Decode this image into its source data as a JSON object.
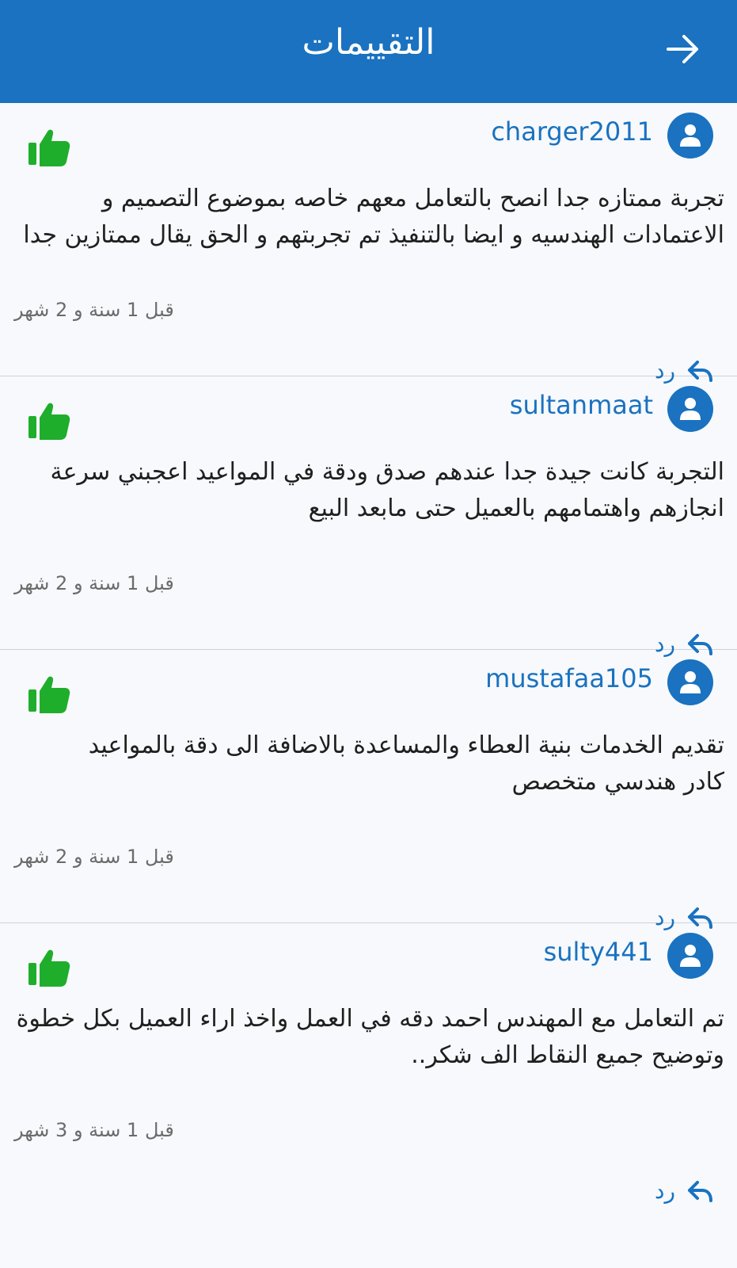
{
  "header": {
    "title": "التقييمات",
    "back_icon": "arrow-right-icon",
    "background": "#1a72c0"
  },
  "reviews": [
    {
      "username": "charger2011",
      "text": "تجربة ممتازه جدا انصح بالتعامل معهم خاصه بموضوع التصميم و الاعتمادات الهندسيه و ايضا بالتنفيذ تم تجربتهم و الحق يقال ممتازين جدا",
      "time": "قبل 1 سنة و 2 شهر",
      "reply_label": "رد"
    },
    {
      "username": "sultanmaat",
      "text": "التجربة كانت جيدة جدا عندهم صدق ودقة في المواعيد اعجبني سرعة انجازهم واهتمامهم بالعميل حتى مابعد البيع",
      "time": "قبل 1 سنة و 2 شهر",
      "reply_label": "رد"
    },
    {
      "username": "mustafaa105",
      "text": "تقديم الخدمات بنية العطاء والمساعدة بالاضافة الى دقة بالمواعيد\nكادر هندسي متخصص",
      "time": "قبل 1 سنة و 2 شهر",
      "reply_label": "رد"
    },
    {
      "username": "sulty441",
      "text": "تم التعامل مع المهندس احمد دقه في العمل واخذ اراء العميل بكل خطوة وتوضيح جميع النقاط الف شكر..",
      "time": "قبل 1 سنة و 3 شهر",
      "reply_label": "رد"
    }
  ],
  "colors": {
    "accent": "#1a72c0",
    "like": "#1fae2b",
    "text": "#1f1f1f",
    "muted": "#6b6b6b"
  },
  "icons": {
    "avatar": "user-avatar-icon",
    "like": "thumbs-up-icon",
    "reply": "reply-icon"
  }
}
